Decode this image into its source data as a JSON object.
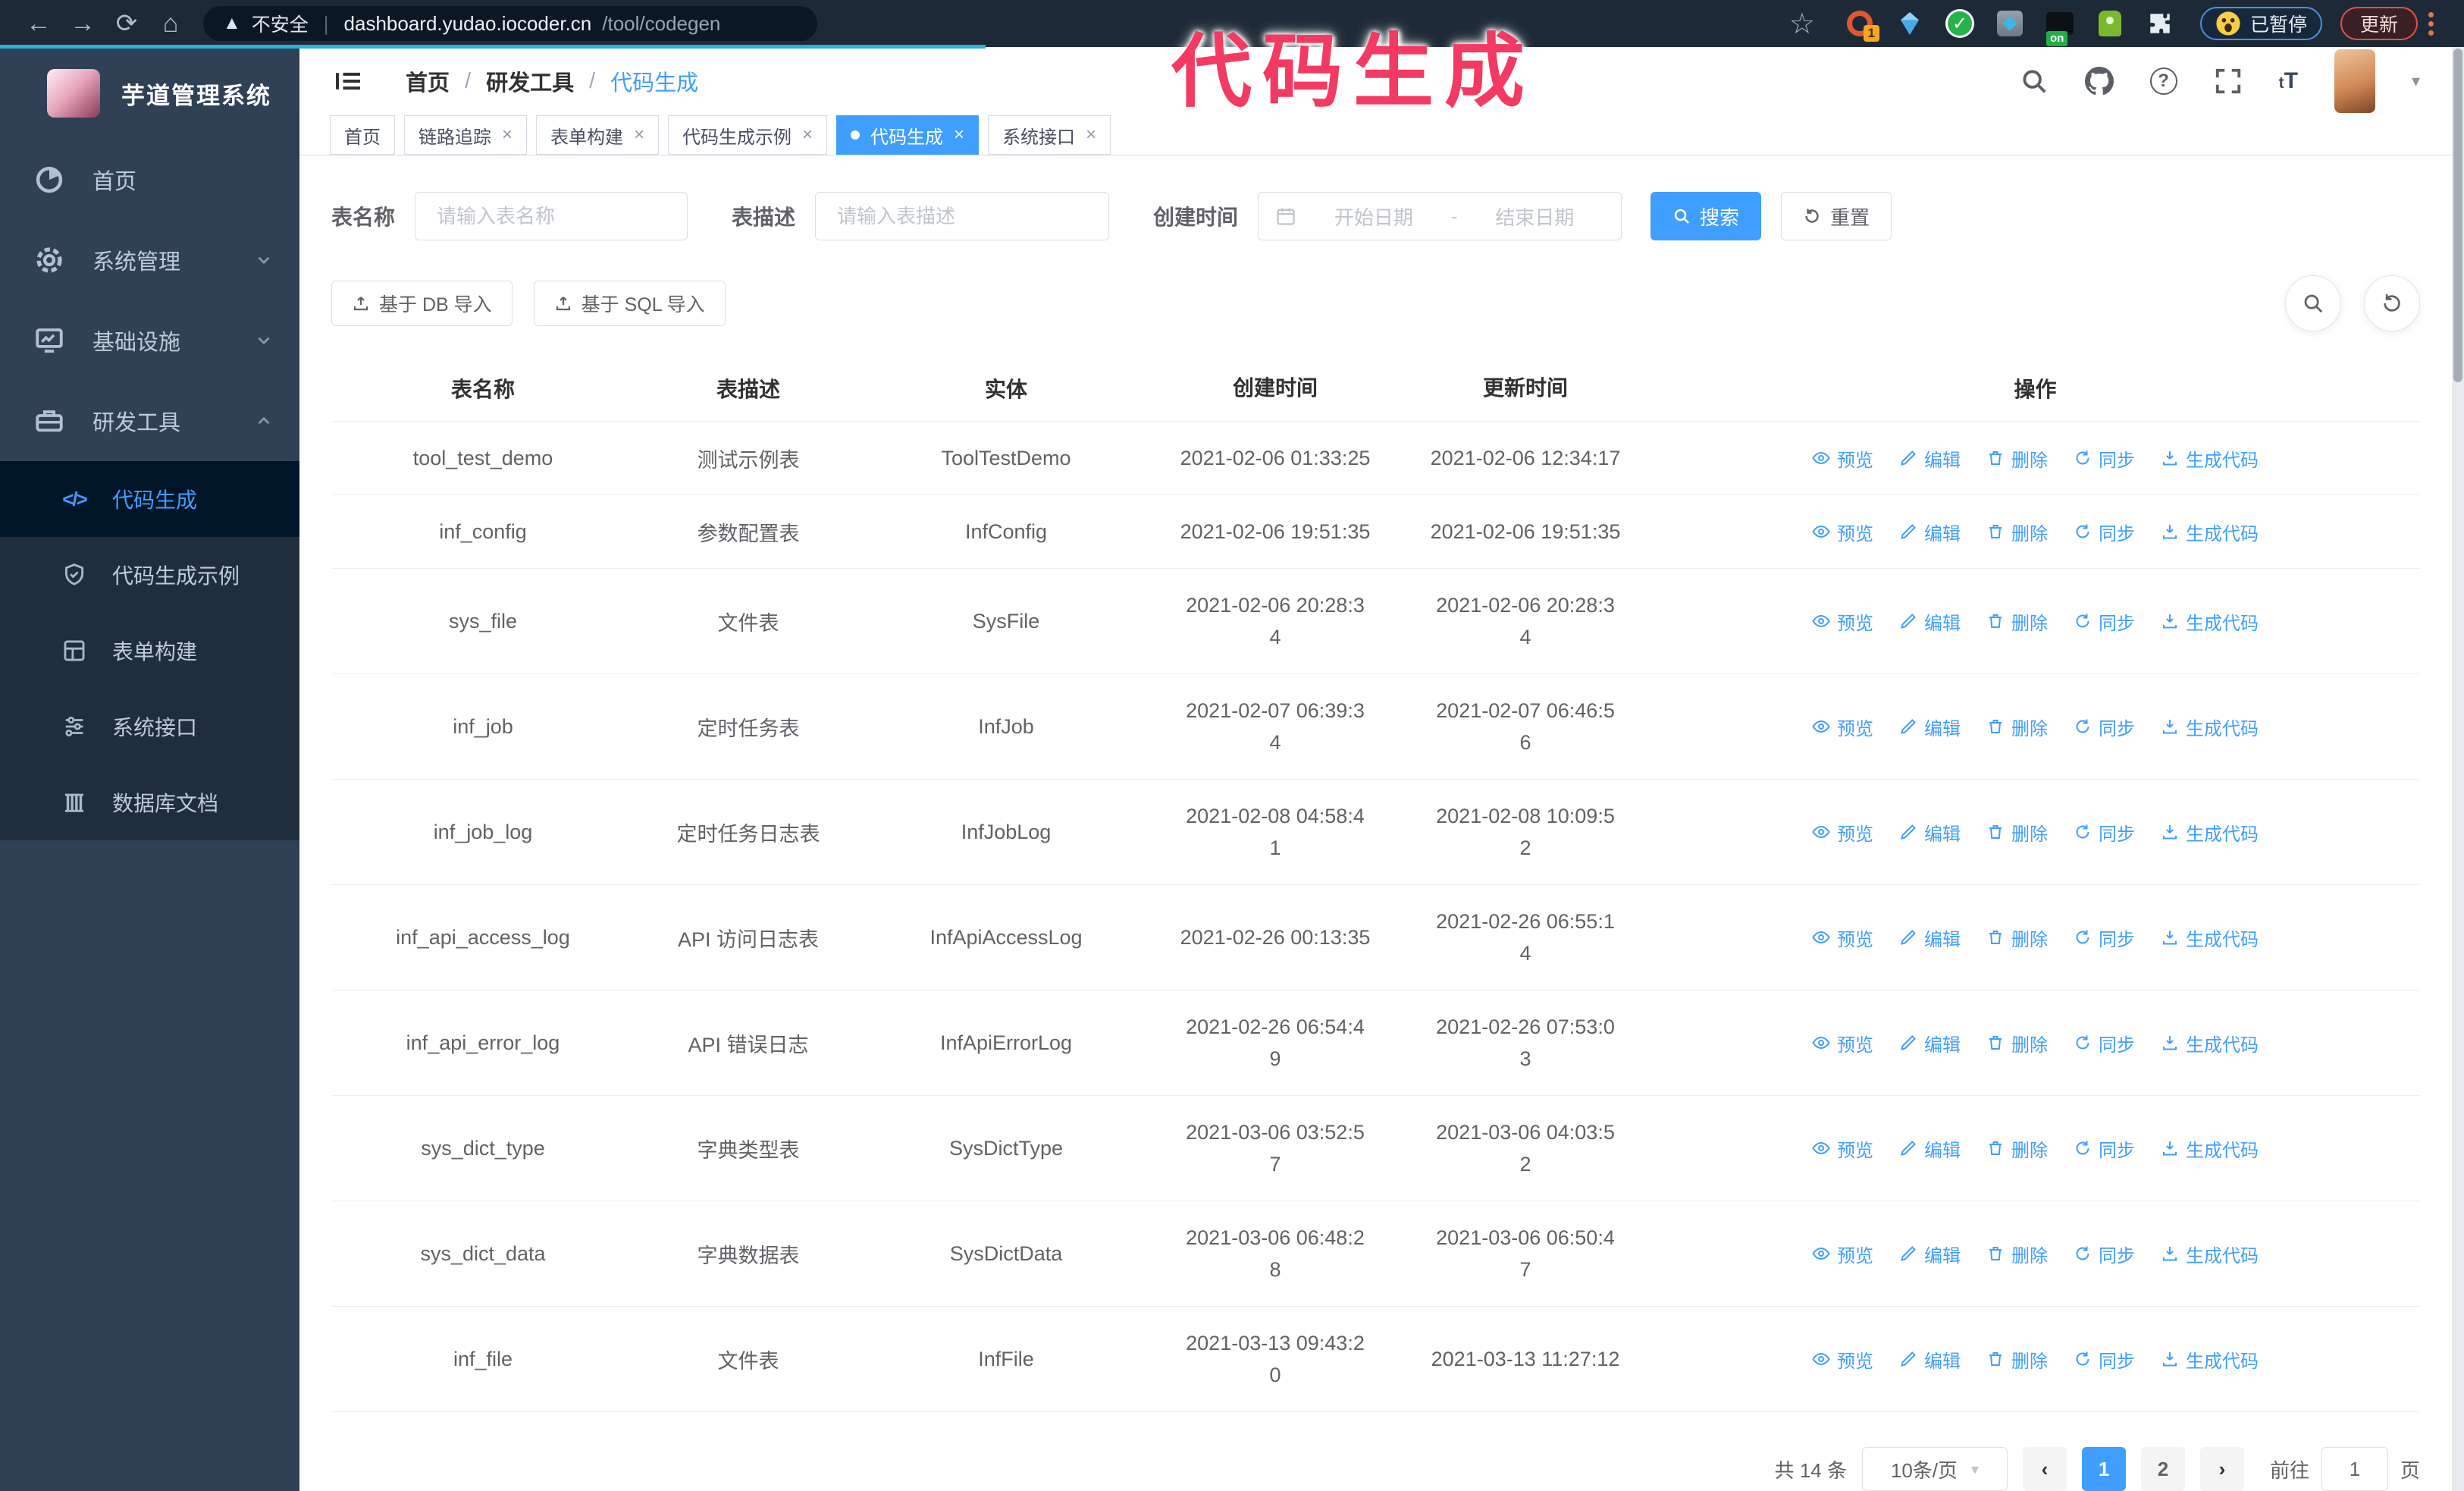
{
  "browser": {
    "security_label": "不安全",
    "url_domain": "dashboard.yudao.iocoder.cn",
    "url_path": "/tool/codegen",
    "extension_badge": "1",
    "extension_on_badge": "on",
    "profile_chip_label": "已暂停",
    "update_button_label": "更新"
  },
  "annotation": {
    "text": "代码生成",
    "color": "#f23a62"
  },
  "sidebar": {
    "title": "芋道管理系统",
    "items": [
      {
        "label": "首页"
      },
      {
        "label": "系统管理"
      },
      {
        "label": "基础设施"
      },
      {
        "label": "研发工具"
      }
    ],
    "subitems": [
      {
        "label": "代码生成",
        "active": true
      },
      {
        "label": "代码生成示例"
      },
      {
        "label": "表单构建"
      },
      {
        "label": "系统接口"
      },
      {
        "label": "数据库文档"
      }
    ]
  },
  "header": {
    "breadcrumb": [
      "首页",
      "研发工具",
      "代码生成"
    ]
  },
  "tabs": [
    {
      "label": "首页"
    },
    {
      "label": "链路追踪"
    },
    {
      "label": "表单构建"
    },
    {
      "label": "代码生成示例"
    },
    {
      "label": "代码生成"
    },
    {
      "label": "系统接口"
    }
  ],
  "filters": {
    "name_label": "表名称",
    "name_placeholder": "请输入表名称",
    "desc_label": "表描述",
    "desc_placeholder": "请输入表描述",
    "time_label": "创建时间",
    "start_placeholder": "开始日期",
    "range_separator": "-",
    "end_placeholder": "结束日期",
    "search_label": "搜索",
    "reset_label": "重置"
  },
  "toolbar": {
    "import_db_label": "基于 DB 导入",
    "import_sql_label": "基于 SQL 导入"
  },
  "table": {
    "columns": [
      "表名称",
      "表描述",
      "实体",
      "创建时间",
      "更新时间",
      "操作"
    ],
    "actions": [
      "预览",
      "编辑",
      "删除",
      "同步",
      "生成代码"
    ],
    "rows": [
      {
        "name": "tool_test_demo",
        "desc": "测试示例表",
        "entity": "ToolTestDemo",
        "created": "2021-02-06 01:33:25",
        "updated": "2021-02-06 12:34:17"
      },
      {
        "name": "inf_config",
        "desc": "参数配置表",
        "entity": "InfConfig",
        "created": "2021-02-06 19:51:35",
        "updated": "2021-02-06 19:51:35"
      },
      {
        "name": "sys_file",
        "desc": "文件表",
        "entity": "SysFile",
        "created": "2021-02-06 20:28:3\n4",
        "updated": "2021-02-06 20:28:3\n4"
      },
      {
        "name": "inf_job",
        "desc": "定时任务表",
        "entity": "InfJob",
        "created": "2021-02-07 06:39:3\n4",
        "updated": "2021-02-07 06:46:5\n6"
      },
      {
        "name": "inf_job_log",
        "desc": "定时任务日志表",
        "entity": "InfJobLog",
        "created": "2021-02-08 04:58:4\n1",
        "updated": "2021-02-08 10:09:5\n2"
      },
      {
        "name": "inf_api_access_log",
        "desc": "API 访问日志表",
        "entity": "InfApiAccessLog",
        "created": "2021-02-26 00:13:35",
        "updated": "2021-02-26 06:55:1\n4"
      },
      {
        "name": "inf_api_error_log",
        "desc": "API 错误日志",
        "entity": "InfApiErrorLog",
        "created": "2021-02-26 06:54:4\n9",
        "updated": "2021-02-26 07:53:0\n3"
      },
      {
        "name": "sys_dict_type",
        "desc": "字典类型表",
        "entity": "SysDictType",
        "created": "2021-03-06 03:52:5\n7",
        "updated": "2021-03-06 04:03:5\n2"
      },
      {
        "name": "sys_dict_data",
        "desc": "字典数据表",
        "entity": "SysDictData",
        "created": "2021-03-06 06:48:2\n8",
        "updated": "2021-03-06 06:50:4\n7"
      },
      {
        "name": "inf_file",
        "desc": "文件表",
        "entity": "InfFile",
        "created": "2021-03-13 09:43:2\n0",
        "updated": "2021-03-13 11:27:12"
      }
    ]
  },
  "pagination": {
    "total": "共 14 条",
    "page_size": "10条/页",
    "pages": [
      "1",
      "2"
    ],
    "active_page": "1",
    "goto_label": "前往",
    "goto_value": "1",
    "page_suffix": "页"
  },
  "colors": {
    "accent": "#409eff",
    "sidebar": "#304156",
    "submenu": "#1f2d3d",
    "annotation": "#f23a62"
  }
}
